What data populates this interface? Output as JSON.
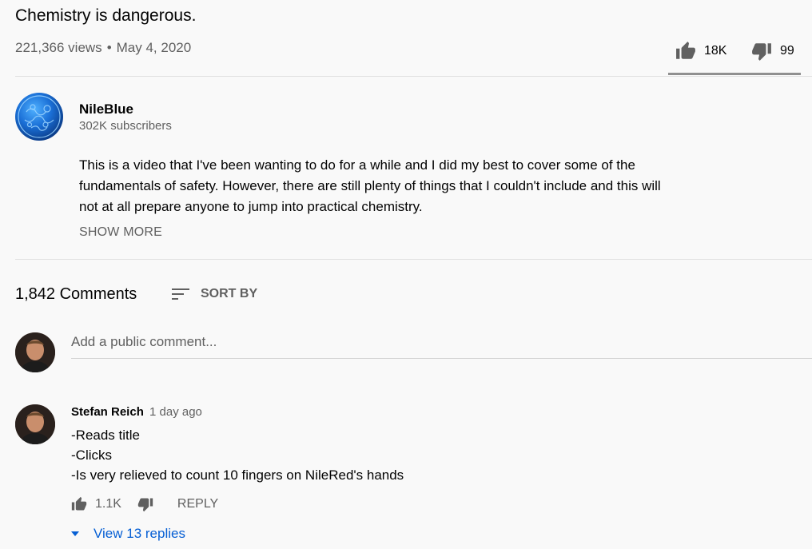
{
  "video": {
    "title": "Chemistry is dangerous.",
    "views": "221,366 views",
    "separator": "•",
    "date": "May 4, 2020",
    "likes": "18K",
    "dislikes": "99"
  },
  "channel": {
    "name": "NileBlue",
    "subscribers": "302K subscribers",
    "description_lines": [
      "This is a video that I've been wanting to do for a while and I did my best to cover some of the",
      "fundamentals of safety. However, there are still plenty of things that I couldn't include and this will",
      "not at all prepare anyone to jump into practical chemistry."
    ],
    "show_more": "SHOW MORE"
  },
  "comments": {
    "count": "1,842 Comments",
    "sort_label": "SORT BY",
    "input_placeholder": "Add a public comment...",
    "items": [
      {
        "author": "Stefan Reich",
        "time": "1 day ago",
        "lines": [
          "-Reads title",
          "-Clicks",
          "-Is very relieved to count 10 fingers on NileRed's hands"
        ],
        "likes": "1.1K",
        "reply_label": "REPLY",
        "view_replies": "View 13 replies"
      }
    ]
  },
  "icons": {
    "like": "thumb-up-icon",
    "dislike": "thumb-down-icon",
    "sort": "sort-icon",
    "expand": "caret-down-icon"
  },
  "colors": {
    "background": "#f9f9f9",
    "text_primary": "#030303",
    "text_secondary": "#606060",
    "link_blue": "#065fd4",
    "divider": "#e0e0e0"
  }
}
